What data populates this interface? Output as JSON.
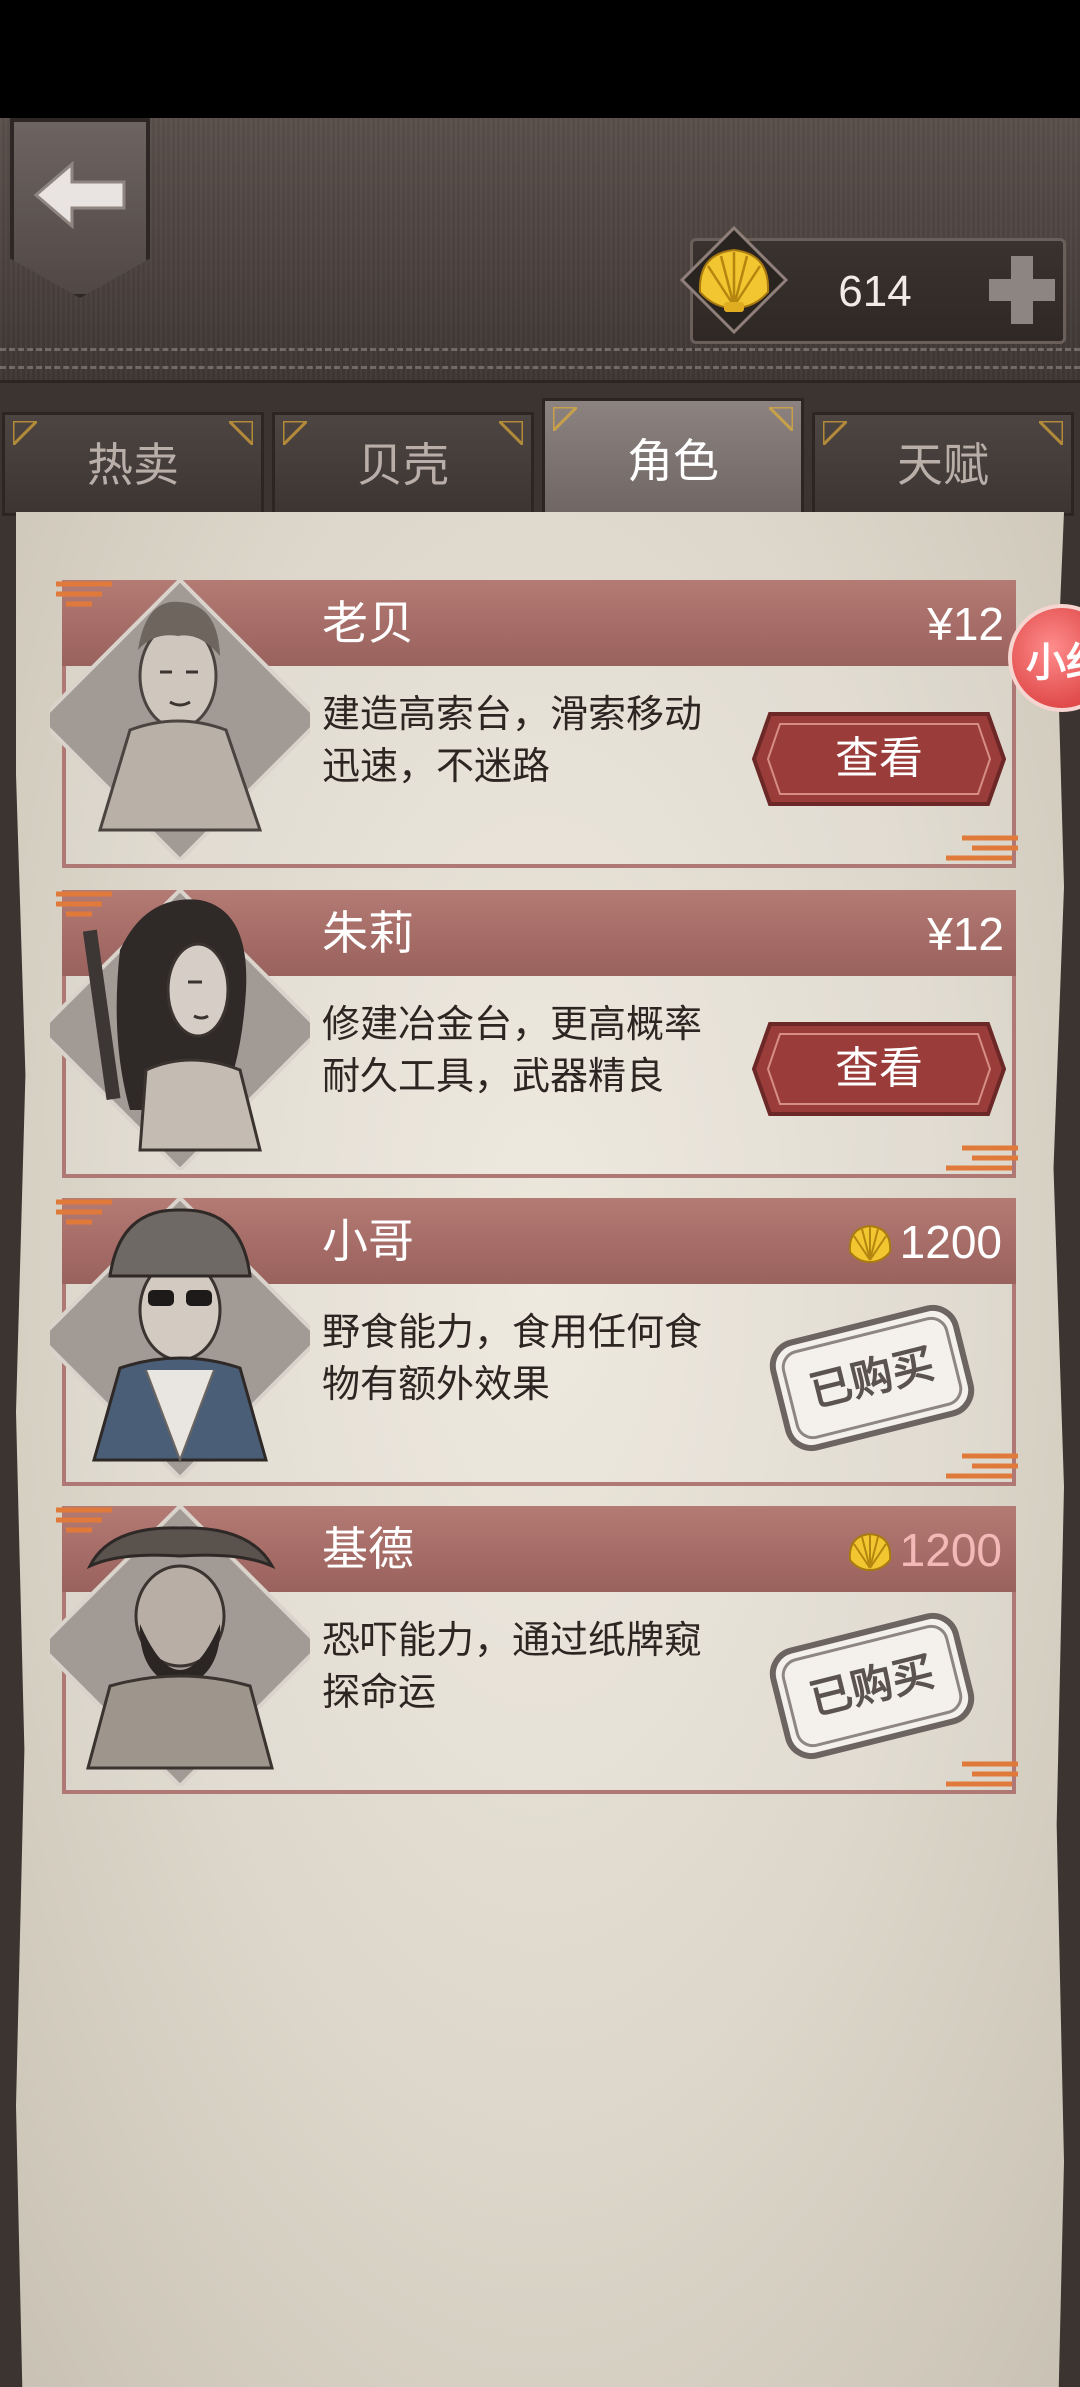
{
  "header": {
    "shell_count": "614"
  },
  "tabs": [
    {
      "label": "热卖",
      "active": false
    },
    {
      "label": "贝壳",
      "active": false
    },
    {
      "label": "角色",
      "active": true
    },
    {
      "label": "天赋",
      "active": false
    }
  ],
  "side_badge": {
    "text": "小红"
  },
  "characters": [
    {
      "name": "老贝",
      "description": "建造高索台，滑索移动迅速，不迷路",
      "price": "¥12",
      "price_type": "yen",
      "action": "查看"
    },
    {
      "name": "朱莉",
      "description": "修建冶金台，更高概率耐久工具，武器精良",
      "price": "¥12",
      "price_type": "yen",
      "action": "查看"
    },
    {
      "name": "小哥",
      "description": "野食能力，食用任何食物有额外效果",
      "price": "1200",
      "price_type": "shell",
      "price_color": "#ffffff",
      "action": "已购买"
    },
    {
      "name": "基德",
      "description": "恐吓能力，通过纸牌窥探命运",
      "price": "1200",
      "price_type": "shell",
      "price_color": "#f2b9b6",
      "action": "已购买"
    }
  ],
  "colors": {
    "card_header": "#a66a64",
    "view_button": "#9a3c3a",
    "shell_gold": "#e8b92a"
  }
}
